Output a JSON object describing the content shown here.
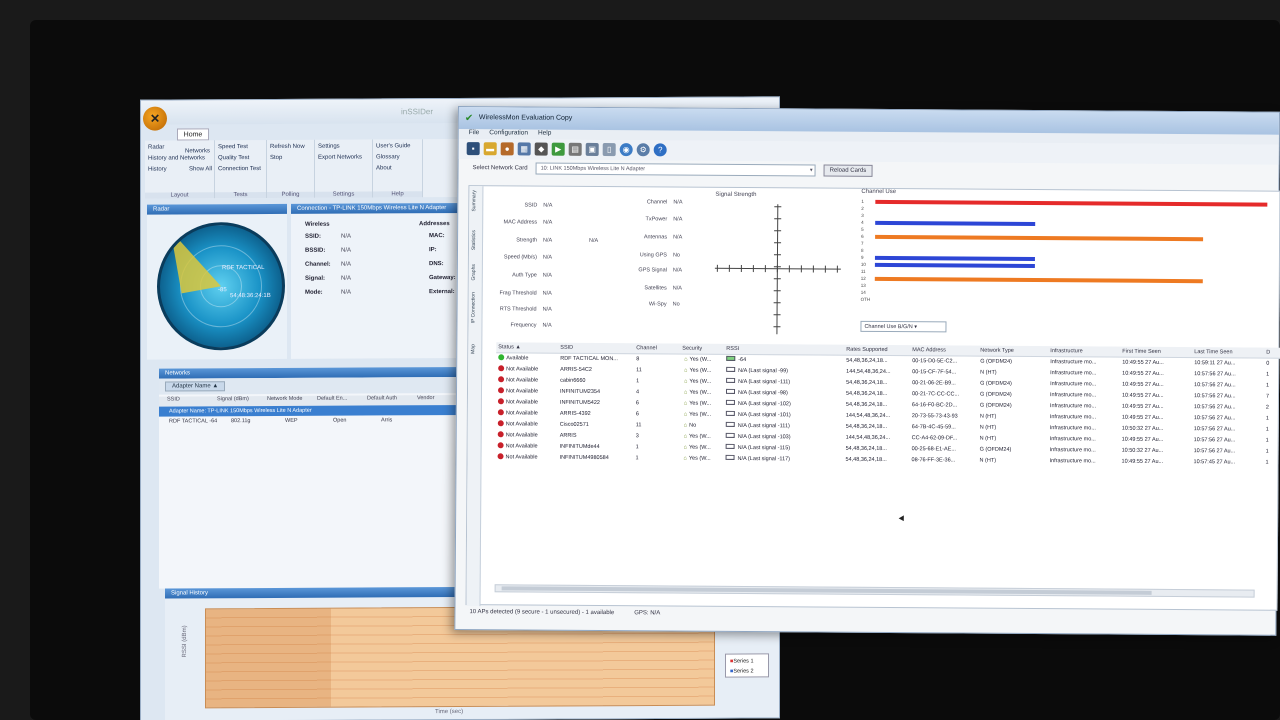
{
  "back_window": {
    "title": "inSSIDer",
    "home_tab": "Home",
    "ribbon": {
      "layout": {
        "items": [
          "Radar",
          "History and Networks",
          "History",
          "Networks",
          "Show All"
        ],
        "group": "Layout"
      },
      "tests": {
        "items": [
          "Speed Test",
          "Quality Test",
          "Connection Test"
        ],
        "group": "Tests"
      },
      "polling": {
        "items": [
          "Refresh Now",
          "Stop"
        ],
        "group": "Polling"
      },
      "settings": {
        "items": [
          "Settings",
          "Export Networks"
        ],
        "group": "Settings"
      },
      "help": {
        "items": [
          "User's Guide",
          "Glossary",
          "About"
        ],
        "group": "Help"
      }
    },
    "radar_panel": {
      "title": "Radar",
      "label_ssid": "RDF TACTICAL",
      "label_sub": "-85",
      "label_mac": "54:48:36:24:1B"
    },
    "connection_panel": {
      "title": "Connection - TP-LINK 150Mbps Wireless Lite N Adapter",
      "wireless_hdr": "Wireless",
      "addresses_hdr": "Addresses",
      "rows": [
        {
          "k": "SSID:",
          "v": "N/A",
          "k2": "MAC:"
        },
        {
          "k": "BSSID:",
          "v": "N/A",
          "k2": "IP:"
        },
        {
          "k": "Channel:",
          "v": "N/A",
          "k2": "DNS:"
        },
        {
          "k": "Signal:",
          "v": "N/A",
          "k2": "Gateway:"
        },
        {
          "k": "Mode:",
          "v": "N/A",
          "k2": "External:"
        }
      ]
    },
    "networks_panel": {
      "title": "Networks",
      "adapter_button": "Adapter Name ▲",
      "columns": [
        "SSID",
        "Signal (dBm)",
        "Network Mode",
        "Default En...",
        "Default Auth",
        "Vendor"
      ],
      "adapter_row": "Adapter Name: TP-LINK 150Mbps Wireless Lite N Adapter",
      "row": [
        "RDF TACTICAL -64",
        "802.11g",
        "WEP",
        "Open",
        "Arris"
      ]
    },
    "signal_history": {
      "title": "Signal History",
      "ylabel": "RSSI (dBm)",
      "xlabel": "Time (sec)",
      "legend": [
        "Series 1",
        "Series 2"
      ]
    }
  },
  "front_window": {
    "title": "WirelessMon Evaluation Copy",
    "menu": [
      "File",
      "Configuration",
      "Help"
    ],
    "select_label": "Select Network Card",
    "card_value": "10: LINK 150Mbps Wireless Lite N Adapter",
    "reload_button": "Reload Cards",
    "vertical_tabs": [
      "Summary",
      "Statistics",
      "Graphs",
      "IP Connection",
      "Map"
    ],
    "summary_left": [
      {
        "k": "SSID",
        "v": "N/A"
      },
      {
        "k": "MAC Address",
        "v": "N/A"
      },
      {
        "k": "Strength",
        "v": "N/A",
        "v2": "N/A"
      },
      {
        "k": "Speed (Mb/s)",
        "v": "N/A"
      },
      {
        "k": "Auth Type",
        "v": "N/A"
      },
      {
        "k": "Frag Threshold",
        "v": "N/A"
      },
      {
        "k": "RTS Threshold",
        "v": "N/A"
      },
      {
        "k": "Frequency",
        "v": "N/A"
      }
    ],
    "summary_mid": [
      {
        "k": "Channel",
        "v": "N/A"
      },
      {
        "k": "TxPower",
        "v": "N/A"
      },
      {
        "k": "Antennas",
        "v": "N/A"
      },
      {
        "k": "Using GPS",
        "v": "No"
      },
      {
        "k": "GPS Signal",
        "v": "N/A"
      },
      {
        "k": "Satellites",
        "v": "N/A"
      },
      {
        "k": "Wi-Spy",
        "v": "No"
      }
    ],
    "signal_strength_label": "Signal Strength",
    "channel_use_label": "Channel Use",
    "channel_numbers": [
      "1",
      "2",
      "3",
      "4",
      "5",
      "6",
      "7",
      "8",
      "9",
      "10",
      "11",
      "12",
      "13",
      "14",
      "OTH"
    ],
    "channel_bars": [
      {
        "channel": "1",
        "fraction": 0.98,
        "color": "#e52a2a"
      },
      {
        "channel": "4",
        "fraction": 0.4,
        "color": "#2d46d6"
      },
      {
        "channel": "6",
        "fraction": 0.82,
        "color": "#ee7a22"
      },
      {
        "channel": "9",
        "fraction": 0.4,
        "color": "#2d46d6"
      },
      {
        "channel": "10",
        "fraction": 0.4,
        "color": "#2d46d6"
      },
      {
        "channel": "12",
        "fraction": 0.82,
        "color": "#ee7a22"
      }
    ],
    "channel_select": "Channel Use B/G/N",
    "table": {
      "columns": [
        "Status ▲",
        "SSID",
        "Channel",
        "Security",
        "RSSI",
        "Rates Supported",
        "MAC Address",
        "Network Type",
        "Infrastructure",
        "First Time Seen",
        "Last Time Seen",
        "D"
      ],
      "rows": [
        {
          "status": "Available",
          "ok": true,
          "ssid": "RDF TACTICAL MON...",
          "channel": "8",
          "security": "Yes (W...",
          "rssi": "-64",
          "rates": "54,48,36,24,18...",
          "mac": "00-15-D0-5E-C2...",
          "ntype": "G (OFDM24)",
          "infra": "Infrastructure mo...",
          "first": "10:49:55 27 Au...",
          "last": "10:59:11 27 Au...",
          "d": "0"
        },
        {
          "status": "Not Available",
          "ok": false,
          "ssid": "ARRIS-54C2",
          "channel": "11",
          "security": "Yes (W...",
          "rssi": "N/A (Last signal -99)",
          "rates": "144,54,48,36,24...",
          "mac": "00-15-CF-7F-54...",
          "ntype": "N (HT)",
          "infra": "Infrastructure mo...",
          "first": "10:49:55 27 Au...",
          "last": "10:57:56 27 Au...",
          "d": "1"
        },
        {
          "status": "Not Available",
          "ok": false,
          "ssid": "cabin6660",
          "channel": "1",
          "security": "Yes (W...",
          "rssi": "N/A (Last signal -111)",
          "rates": "54,48,36,24,18...",
          "mac": "00-21-06-2E-B9...",
          "ntype": "G (OFDM24)",
          "infra": "Infrastructure mo...",
          "first": "10:49:55 27 Au...",
          "last": "10:57:56 27 Au...",
          "d": "1"
        },
        {
          "status": "Not Available",
          "ok": false,
          "ssid": "INFINITUM2354",
          "channel": "4",
          "security": "Yes (W...",
          "rssi": "N/A (Last signal -98)",
          "rates": "54,48,36,24,18...",
          "mac": "00-21-7C-CC-CC...",
          "ntype": "G (OFDM24)",
          "infra": "Infrastructure mo...",
          "first": "10:49:55 27 Au...",
          "last": "10:57:56 27 Au...",
          "d": "7"
        },
        {
          "status": "Not Available",
          "ok": false,
          "ssid": "INFINITUM5422",
          "channel": "6",
          "security": "Yes (W...",
          "rssi": "N/A (Last signal -102)",
          "rates": "54,48,36,24,18...",
          "mac": "64-16-F0-BC-2D...",
          "ntype": "G (OFDM24)",
          "infra": "Infrastructure mo...",
          "first": "10:49:55 27 Au...",
          "last": "10:57:56 27 Au...",
          "d": "2"
        },
        {
          "status": "Not Available",
          "ok": false,
          "ssid": "ARRIS-4392",
          "channel": "6",
          "security": "Yes (W...",
          "rssi": "N/A (Last signal -101)",
          "rates": "144,54,48,36,24...",
          "mac": "20-73-55-73-43-93",
          "ntype": "N (HT)",
          "infra": "Infrastructure mo...",
          "first": "10:49:55 27 Au...",
          "last": "10:57:56 27 Au...",
          "d": "1"
        },
        {
          "status": "Not Available",
          "ok": false,
          "ssid": "Cisco02571",
          "channel": "11",
          "security": "No",
          "rssi": "N/A (Last signal -111)",
          "rates": "54,48,36,24,18...",
          "mac": "64-7B-4C-45-59...",
          "ntype": "N (HT)",
          "infra": "Infrastructure mo...",
          "first": "10:50:32 27 Au...",
          "last": "10:57:56 27 Au...",
          "d": "1"
        },
        {
          "status": "Not Available",
          "ok": false,
          "ssid": "ARRIS",
          "channel": "3",
          "security": "Yes (W...",
          "rssi": "N/A (Last signal -103)",
          "rates": "144,54,48,36,24...",
          "mac": "CC-A4-62-09-DF...",
          "ntype": "N (HT)",
          "infra": "Infrastructure mo...",
          "first": "10:49:55 27 Au...",
          "last": "10:57:56 27 Au...",
          "d": "1"
        },
        {
          "status": "Not Available",
          "ok": false,
          "ssid": "INFINITUMde44",
          "channel": "1",
          "security": "Yes (W...",
          "rssi": "N/A (Last signal -115)",
          "rates": "54,48,36,24,18...",
          "mac": "00-25-68-E1-AE...",
          "ntype": "G (OFDM24)",
          "infra": "Infrastructure mo...",
          "first": "10:50:32 27 Au...",
          "last": "10:57:56 27 Au...",
          "d": "1"
        },
        {
          "status": "Not Available",
          "ok": false,
          "ssid": "INFINITUM4980584",
          "channel": "1",
          "security": "Yes (W...",
          "rssi": "N/A (Last signal -117)",
          "rates": "54,48,36,24,18...",
          "mac": "08-76-FF-3E-36...",
          "ntype": "N (HT)",
          "infra": "Infrastructure mo...",
          "first": "10:49:55 27 Au...",
          "last": "10:57:45 27 Au...",
          "d": "1"
        }
      ]
    },
    "status_left": "10 APs detected (9 secure - 1 unsecured) - 1 available",
    "status_gps": "GPS: N/A"
  }
}
